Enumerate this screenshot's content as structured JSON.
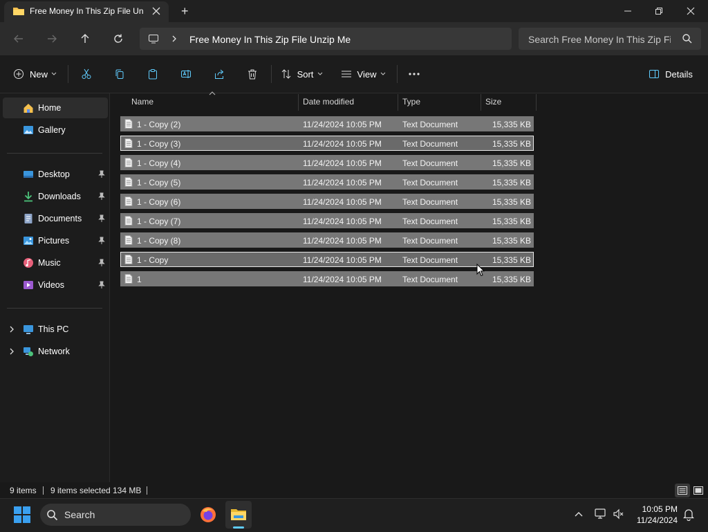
{
  "window": {
    "tab_title": "Free Money In This Zip File Un",
    "add_tab": "+"
  },
  "address": {
    "path": "Free Money In This Zip File Unzip Me",
    "search_placeholder": "Search Free Money In This Zip File Unzip Me"
  },
  "commands": {
    "new": "New",
    "sort": "Sort",
    "view": "View",
    "details": "Details"
  },
  "sidebar": {
    "items": [
      {
        "label": "Home",
        "icon": "home-icon",
        "pinned": false,
        "selected": true
      },
      {
        "label": "Gallery",
        "icon": "gallery-icon",
        "pinned": false
      },
      {
        "label": "Desktop",
        "icon": "desktop-icon",
        "pinned": true
      },
      {
        "label": "Downloads",
        "icon": "downloads-icon",
        "pinned": true
      },
      {
        "label": "Documents",
        "icon": "documents-icon",
        "pinned": true
      },
      {
        "label": "Pictures",
        "icon": "pictures-icon",
        "pinned": true
      },
      {
        "label": "Music",
        "icon": "music-icon",
        "pinned": true
      },
      {
        "label": "Videos",
        "icon": "videos-icon",
        "pinned": true
      },
      {
        "label": "This PC",
        "icon": "this-pc-icon",
        "expandable": true
      },
      {
        "label": "Network",
        "icon": "network-icon",
        "expandable": true
      }
    ]
  },
  "columns": {
    "name": "Name",
    "date": "Date modified",
    "type": "Type",
    "size": "Size"
  },
  "files": [
    {
      "name": "1 - Copy (2)",
      "date": "11/24/2024 10:05 PM",
      "type": "Text Document",
      "size": "15,335 KB",
      "selected": true
    },
    {
      "name": "1 - Copy (3)",
      "date": "11/24/2024 10:05 PM",
      "type": "Text Document",
      "size": "15,335 KB",
      "selected": true,
      "focused": true
    },
    {
      "name": "1 - Copy (4)",
      "date": "11/24/2024 10:05 PM",
      "type": "Text Document",
      "size": "15,335 KB",
      "selected": true
    },
    {
      "name": "1 - Copy (5)",
      "date": "11/24/2024 10:05 PM",
      "type": "Text Document",
      "size": "15,335 KB",
      "selected": true
    },
    {
      "name": "1 - Copy (6)",
      "date": "11/24/2024 10:05 PM",
      "type": "Text Document",
      "size": "15,335 KB",
      "selected": true
    },
    {
      "name": "1 - Copy (7)",
      "date": "11/24/2024 10:05 PM",
      "type": "Text Document",
      "size": "15,335 KB",
      "selected": true
    },
    {
      "name": "1 - Copy (8)",
      "date": "11/24/2024 10:05 PM",
      "type": "Text Document",
      "size": "15,335 KB",
      "selected": true
    },
    {
      "name": "1 - Copy",
      "date": "11/24/2024 10:05 PM",
      "type": "Text Document",
      "size": "15,335 KB",
      "selected": true,
      "focused": true
    },
    {
      "name": "1",
      "date": "11/24/2024 10:05 PM",
      "type": "Text Document",
      "size": "15,335 KB",
      "selected": true
    }
  ],
  "status": {
    "item_count": "9 items",
    "selected": "9 items selected",
    "size": "134 MB"
  },
  "taskbar": {
    "search": "Search",
    "time": "10:05 PM",
    "date": "11/24/2024"
  },
  "colors": {
    "selection": "#777777",
    "accent": "#60cdff",
    "folder": "#f4c04f"
  }
}
